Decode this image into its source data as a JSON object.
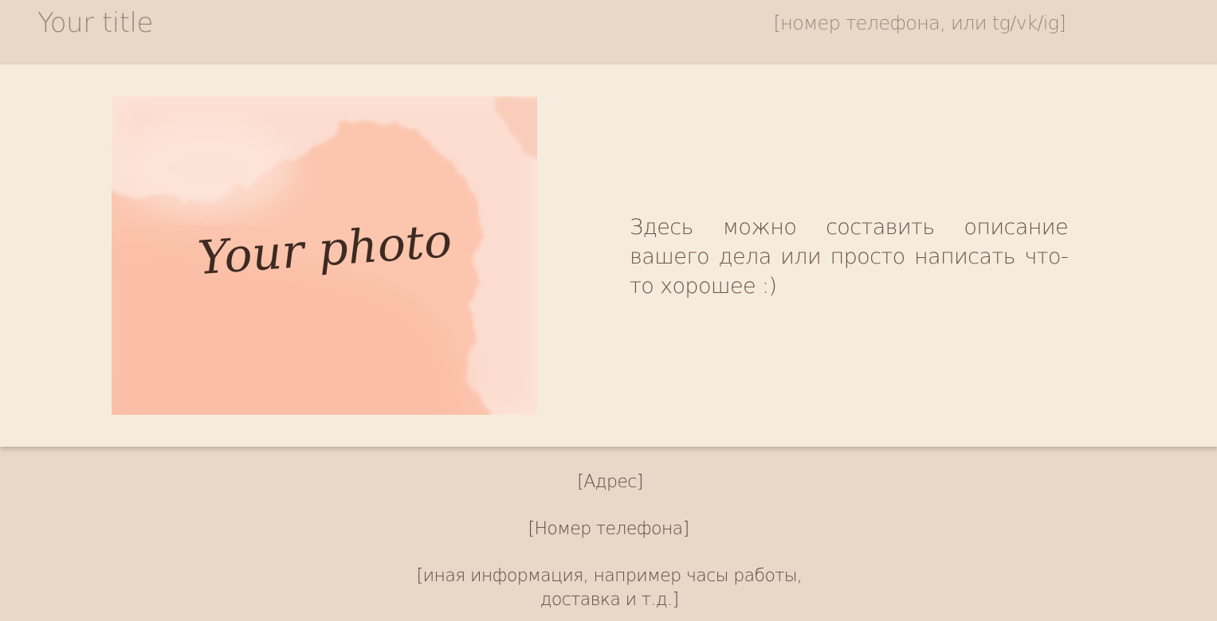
{
  "header": {
    "title": "Your title",
    "contact": "[номер телефона, или tg/vk/ig]"
  },
  "main": {
    "photo_caption": "Your photo",
    "description": "Здесь можно составить описание вашего дела или просто написать что-то хорошее :)"
  },
  "footer": {
    "address": "[Адрес]",
    "phone": "[Номер телефона]",
    "other_line1": "[иная информация, например часы работы,",
    "other_line2": "доставка и т.д.]"
  },
  "colors": {
    "header_bg": "#e7d8c8",
    "main_bg": "#f6ecdd",
    "photo_peach": "#fcc7b0",
    "caption_ink": "#3d2a22"
  }
}
